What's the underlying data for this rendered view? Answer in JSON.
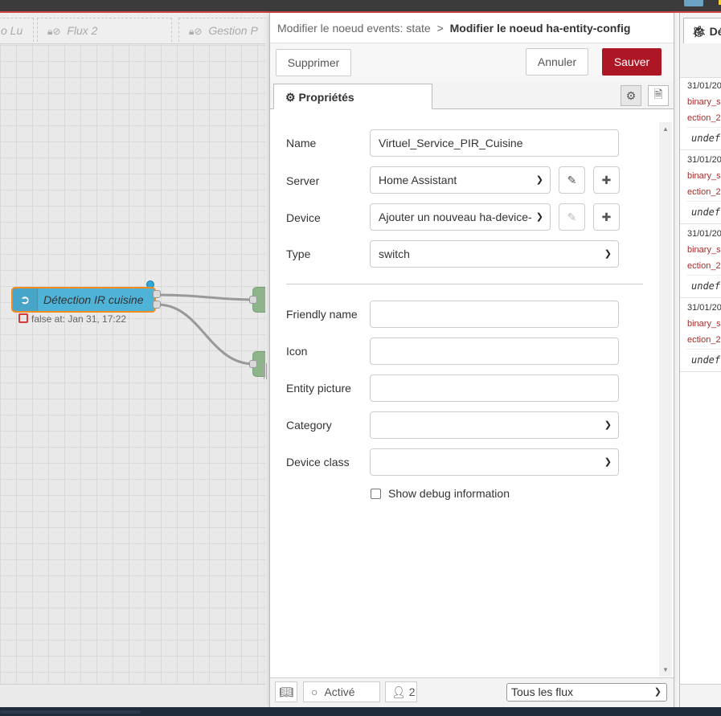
{
  "workspace": {
    "tabs": [
      {
        "label": "o Lu"
      },
      {
        "label": "Flux 2"
      },
      {
        "label": "Gestion P"
      }
    ],
    "node": {
      "label": "Détection IR cuisine",
      "status": "false at: Jan 31, 17:22"
    }
  },
  "tray": {
    "breadcrumb": {
      "parent": "Modifier le noeud events: state",
      "separator": ">",
      "current": "Modifier le noeud ha-entity-config"
    },
    "buttons": {
      "delete": "Supprimer",
      "cancel": "Annuler",
      "save": "Sauver"
    },
    "tab_properties": "Propriétés",
    "form": {
      "name": {
        "label": "Name",
        "value": "Virtuel_Service_PIR_Cuisine"
      },
      "server": {
        "label": "Server",
        "value": "Home Assistant"
      },
      "device": {
        "label": "Device",
        "value": "Ajouter un nouveau ha-device-"
      },
      "type": {
        "label": "Type",
        "value": "switch"
      },
      "friendly_name": {
        "label": "Friendly name",
        "value": ""
      },
      "icon": {
        "label": "Icon",
        "value": ""
      },
      "entity_picture": {
        "label": "Entity picture",
        "value": ""
      },
      "category": {
        "label": "Category",
        "value": ""
      },
      "device_class": {
        "label": "Device class",
        "value": ""
      },
      "debug": {
        "label": "Show debug information",
        "checked": false
      }
    },
    "footer": {
      "status": "Activé",
      "users": "2",
      "scope": "Tous les flux"
    }
  },
  "sidebar": {
    "tab": "Dé",
    "entries": [
      {
        "date": "31/01/20",
        "source": "binary_s",
        "topic": "ection_2",
        "value": "undef"
      },
      {
        "date": "31/01/20",
        "source": "binary_s",
        "topic": "ection_2",
        "value": "undef"
      },
      {
        "date": "31/01/20",
        "source": "binary_s",
        "topic": "ection_2",
        "value": "undef"
      },
      {
        "date": "31/01/20",
        "source": "binary_s",
        "topic": "ection_2",
        "value": "undef"
      }
    ]
  },
  "colors": {
    "primary": "#ad1625",
    "node": "#4fb3d8",
    "node_border": "#f28b20",
    "header_bar": "#3b3b3b"
  }
}
